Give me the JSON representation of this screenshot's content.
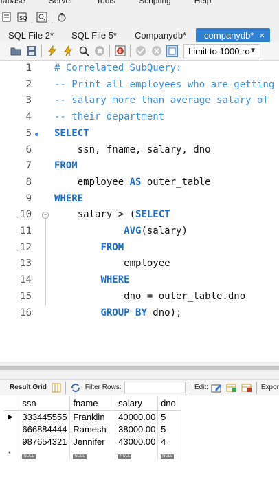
{
  "menu": [
    "atabase",
    "Server",
    "Tools",
    "Scripting",
    "Help"
  ],
  "tabs": [
    {
      "label": "SQL File 2*",
      "active": false
    },
    {
      "label": "SQL File 5*",
      "active": false
    },
    {
      "label": "Companydb*",
      "active": false
    },
    {
      "label": "companydb*",
      "active": true,
      "close": "×"
    }
  ],
  "editor_toolbar": {
    "limit_label": "Limit to 1000 ro",
    "icons": [
      "open-file-icon",
      "save-icon",
      "execute-icon",
      "execute-current-icon",
      "explain-icon",
      "stop-icon",
      "toggle-error-icon",
      "commit-icon",
      "rollback-icon",
      "toggle-output-icon"
    ]
  },
  "code_lines": [
    {
      "n": "1",
      "html": "<span class='cm'># Correlated SubQuery:</span>"
    },
    {
      "n": "2",
      "html": "<span class='cm'>-- Print all employees who are getting</span>"
    },
    {
      "n": "3",
      "html": "<span class='cm'>-- salary more than average salary of</span>"
    },
    {
      "n": "4",
      "html": "<span class='cm'>-- their department</span>"
    },
    {
      "n": "5",
      "html": "<span class='kw'>SELECT</span>"
    },
    {
      "n": "6",
      "html": "    ssn, fname, salary, dno"
    },
    {
      "n": "7",
      "html": "<span class='kw'>FROM</span>"
    },
    {
      "n": "8",
      "html": "    employee <span class='kw'>AS</span> outer_table"
    },
    {
      "n": "9",
      "html": "<span class='kw'>WHERE</span>"
    },
    {
      "n": "10",
      "html": "    salary &gt; (<span class='kw'>SELECT</span>"
    },
    {
      "n": "11",
      "html": "            <span class='fn'>AVG</span>(salary)"
    },
    {
      "n": "12",
      "html": "        <span class='kw'>FROM</span>"
    },
    {
      "n": "13",
      "html": "            employee"
    },
    {
      "n": "14",
      "html": "        <span class='kw'>WHERE</span>"
    },
    {
      "n": "15",
      "html": "            dno = outer_table.dno"
    },
    {
      "n": "16",
      "html": "        <span class='kw'>GROUP BY</span> dno);"
    }
  ],
  "result_toolbar": {
    "result_grid": "Result Grid",
    "filter_rows": "Filter Rows:",
    "edit": "Edit:",
    "export": "Expor"
  },
  "grid": {
    "columns": [
      "ssn",
      "fname",
      "salary",
      "dno"
    ],
    "rows": [
      [
        "333445555",
        "Franklin",
        "40000.00",
        "5"
      ],
      [
        "666884444",
        "Ramesh",
        "38000.00",
        "5"
      ],
      [
        "987654321",
        "Jennifer",
        "43000.00",
        "4"
      ]
    ],
    "null_label": "NULL",
    "new_row_marker": "*"
  }
}
